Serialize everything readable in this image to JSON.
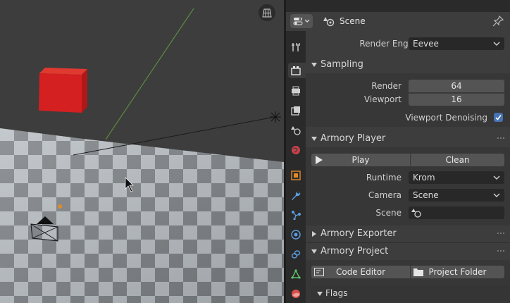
{
  "header": {
    "context_name": "Scene"
  },
  "render": {
    "engine_label": "Render Engine",
    "engine_value": "Eevee"
  },
  "sampling": {
    "title": "Sampling",
    "render_label": "Render",
    "render_value": "64",
    "viewport_label": "Viewport",
    "viewport_value": "16",
    "denoise_label": "Viewport Denoising",
    "denoise_checked": true
  },
  "armory_player": {
    "title": "Armory Player",
    "play_label": "Play",
    "clean_label": "Clean",
    "runtime_label": "Runtime",
    "runtime_value": "Krom",
    "camera_label": "Camera",
    "camera_value": "Scene",
    "scene_label": "Scene",
    "scene_value": ""
  },
  "armory_exporter": {
    "title": "Armory Exporter"
  },
  "armory_project": {
    "title": "Armory Project",
    "code_editor_label": "Code Editor",
    "project_folder_label": "Project Folder",
    "flags_title": "Flags"
  },
  "tabs": [
    "tool-tab",
    "render-tab",
    "output-tab",
    "view-layer-tab",
    "scene-tab",
    "world-tab",
    "object-tab",
    "modifier-tab",
    "particles-tab",
    "physics-tab",
    "constraints-tab",
    "data-tab",
    "material-tab"
  ],
  "colors": {
    "accent": "#4772b3",
    "cube": "#d42020",
    "panel_bg": "#3d3d3d",
    "field_bg": "#545454",
    "dropdown_bg": "#282828"
  }
}
